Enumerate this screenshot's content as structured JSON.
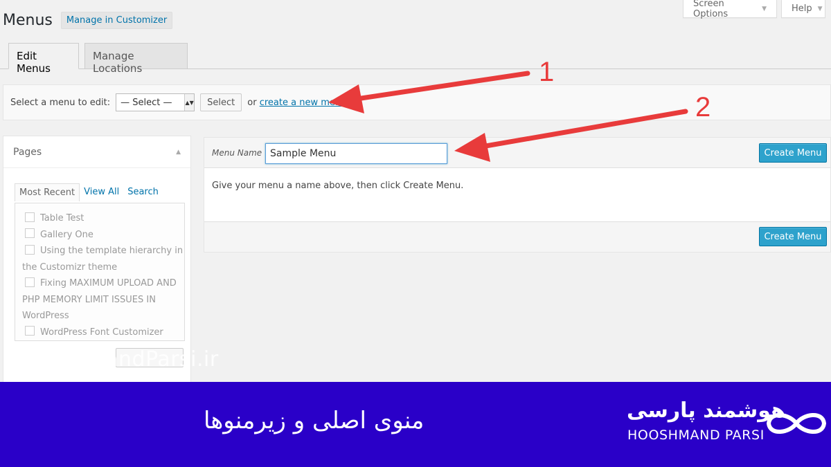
{
  "top_links": {
    "screen_options": "Screen Options",
    "help": "Help"
  },
  "header": {
    "title": "Menus",
    "customizer_button": "Manage in Customizer"
  },
  "tabs": [
    {
      "label": "Edit Menus",
      "active": true
    },
    {
      "label": "Manage Locations",
      "active": false
    }
  ],
  "select_bar": {
    "label": "Select a menu to edit:",
    "select_value": "— Select —",
    "select_button": "Select",
    "or_text": "or",
    "create_link": "create a new menu",
    "period": "."
  },
  "pages_box": {
    "title": "Pages",
    "subtabs": [
      "Most Recent",
      "View All",
      "Search"
    ],
    "items": [
      "Table Test",
      "Gallery One",
      "Using the template hierarchy in",
      "the Customizr theme",
      "Fixing MAXIMUM UPLOAD AND",
      "PHP MEMORY LIMIT ISSUES IN",
      "WordPress",
      "WordPress Font Customizer"
    ]
  },
  "menu_edit": {
    "name_label": "Menu Name",
    "name_value": "Sample Menu",
    "create_button": "Create Menu",
    "instructions": "Give your menu a name above, then click Create Menu."
  },
  "annotations": {
    "arrow_1_number": "1",
    "arrow_2_number": "2",
    "arrow_color": "#e83b3b"
  },
  "watermark": "HooshmandParsi.ir",
  "banner": {
    "title": "منوی اصلی و زیرمنوها",
    "brand_fa": "هوشمند پارسی",
    "brand_en": "HOOSHMAND PARSI",
    "background": "#2a00c8"
  }
}
